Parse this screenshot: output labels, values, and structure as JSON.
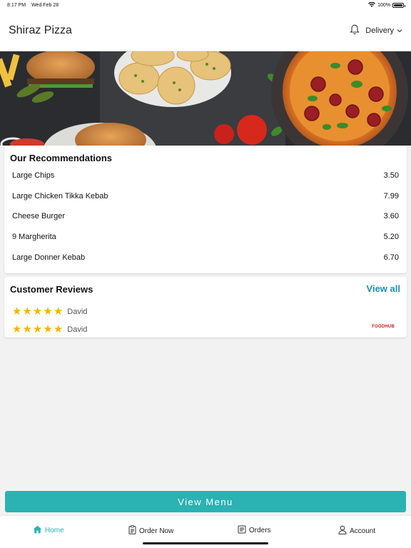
{
  "status": {
    "time": "8:17 PM",
    "date": "Wed Feb 28",
    "battery": "100%",
    "battery_level": 1.0
  },
  "header": {
    "title": "Shiraz Pizza",
    "mode": "Delivery"
  },
  "recommendations": {
    "title": "Our Recommendations",
    "items": [
      {
        "name": "Large Chips",
        "price": "3.50"
      },
      {
        "name": "Large Chicken Tikka Kebab",
        "price": "7.99"
      },
      {
        "name": "Cheese Burger",
        "price": "3.60"
      },
      {
        "name": "9 Margherita",
        "price": "5.20"
      },
      {
        "name": "Large Donner Kebab",
        "price": "6.70"
      }
    ]
  },
  "reviews": {
    "title": "Customer Reviews",
    "view_all": "View all",
    "items": [
      {
        "author": "David",
        "rating": 5
      },
      {
        "author": "David",
        "rating": 5
      }
    ],
    "source_logo": "FOODHUB"
  },
  "view_menu_label": "View Menu",
  "tabs": [
    {
      "label": "Home",
      "icon": "home-icon",
      "active": true
    },
    {
      "label": "Order Now",
      "icon": "clipboard-icon",
      "active": false
    },
    {
      "label": "Orders",
      "icon": "receipt-icon",
      "active": false
    },
    {
      "label": "Account",
      "icon": "person-icon",
      "active": false
    }
  ],
  "colors": {
    "accent": "#2bb2b2",
    "link": "#1f8fb3",
    "star": "#f6b400",
    "brand_logo": "#d01818"
  }
}
